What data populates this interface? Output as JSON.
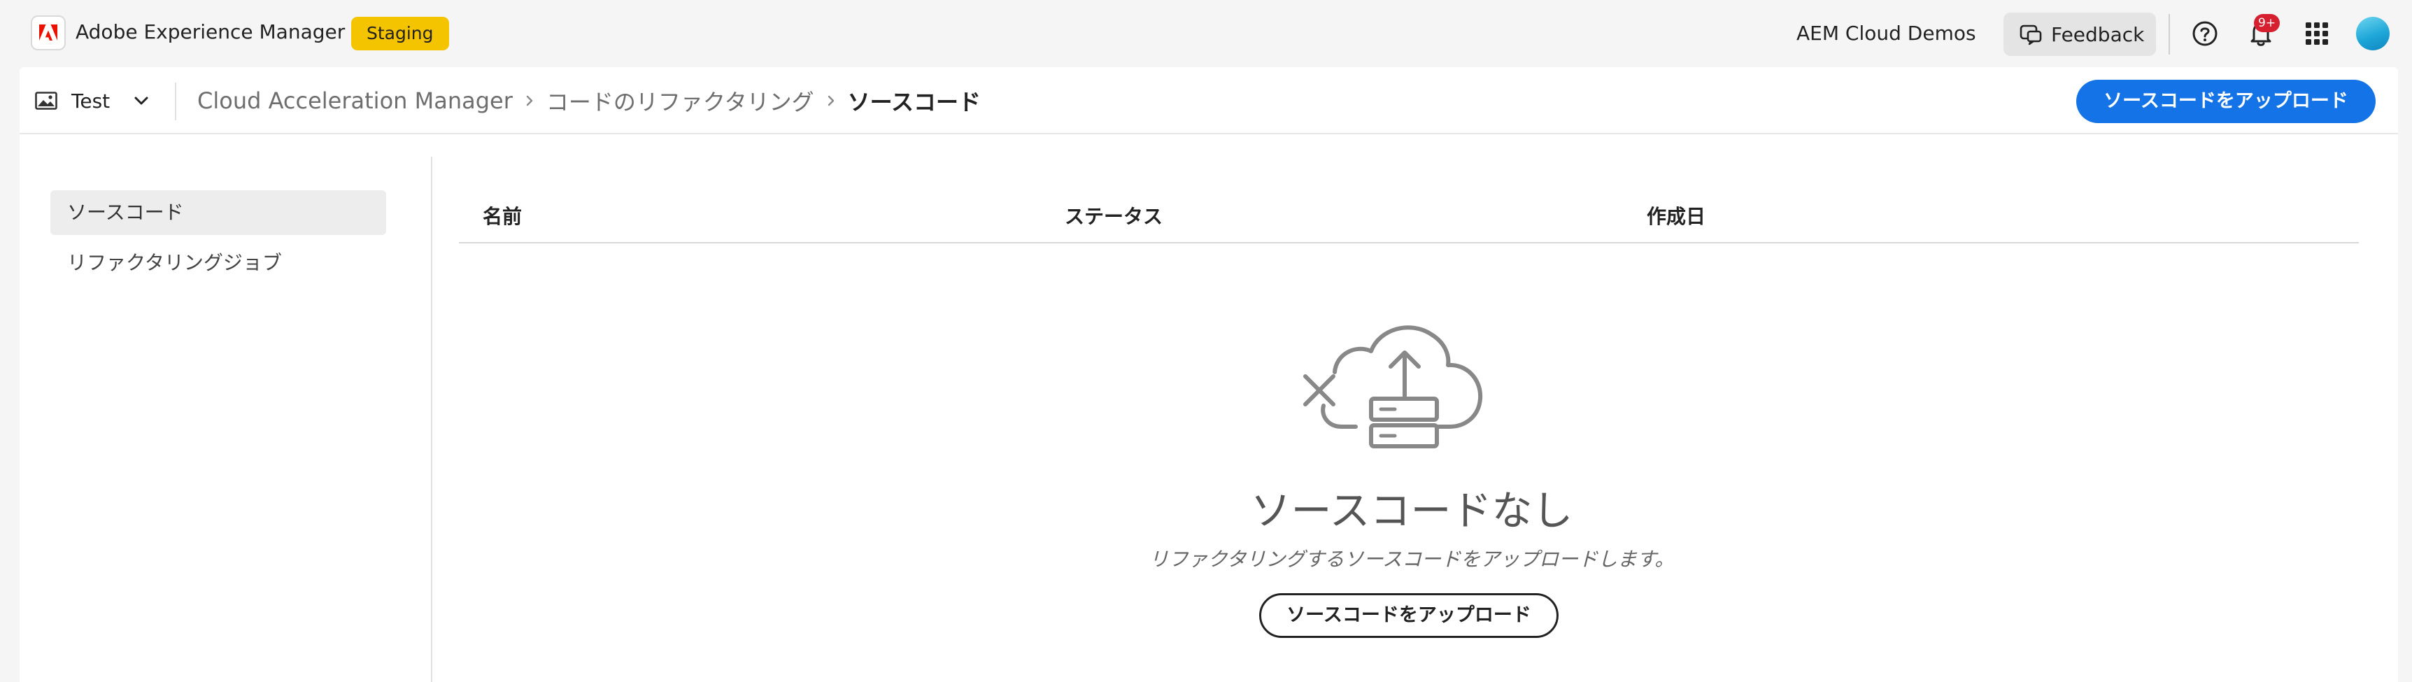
{
  "header": {
    "app_title": "Adobe Experience Manager",
    "environment_badge": "Staging",
    "org_name": "AEM Cloud Demos",
    "feedback_label": "Feedback",
    "notification_count": "9+",
    "icons": [
      "adobe-logo-icon",
      "feedback-icon",
      "help-icon",
      "bell-icon",
      "app-grid-icon",
      "avatar"
    ]
  },
  "toolbar": {
    "program_name": "Test",
    "breadcrumb": [
      "Cloud Acceleration Manager",
      "コードのリファクタリング",
      "ソースコード"
    ],
    "upload_button_label": "ソースコードをアップロード"
  },
  "sidebar": {
    "items": [
      {
        "label": "ソースコード",
        "selected": true
      },
      {
        "label": "リファクタリングジョブ",
        "selected": false
      }
    ]
  },
  "table": {
    "columns": [
      "名前",
      "ステータス",
      "作成日"
    ],
    "rows": []
  },
  "empty_state": {
    "title": "ソースコードなし",
    "description": "リファクタリングするソースコードをアップロードします。",
    "button_label": "ソースコードをアップロード"
  },
  "colors": {
    "accent": "#1473e6",
    "badge": "#f5c400",
    "notification": "#d7202f",
    "background": "#f5f5f5"
  }
}
